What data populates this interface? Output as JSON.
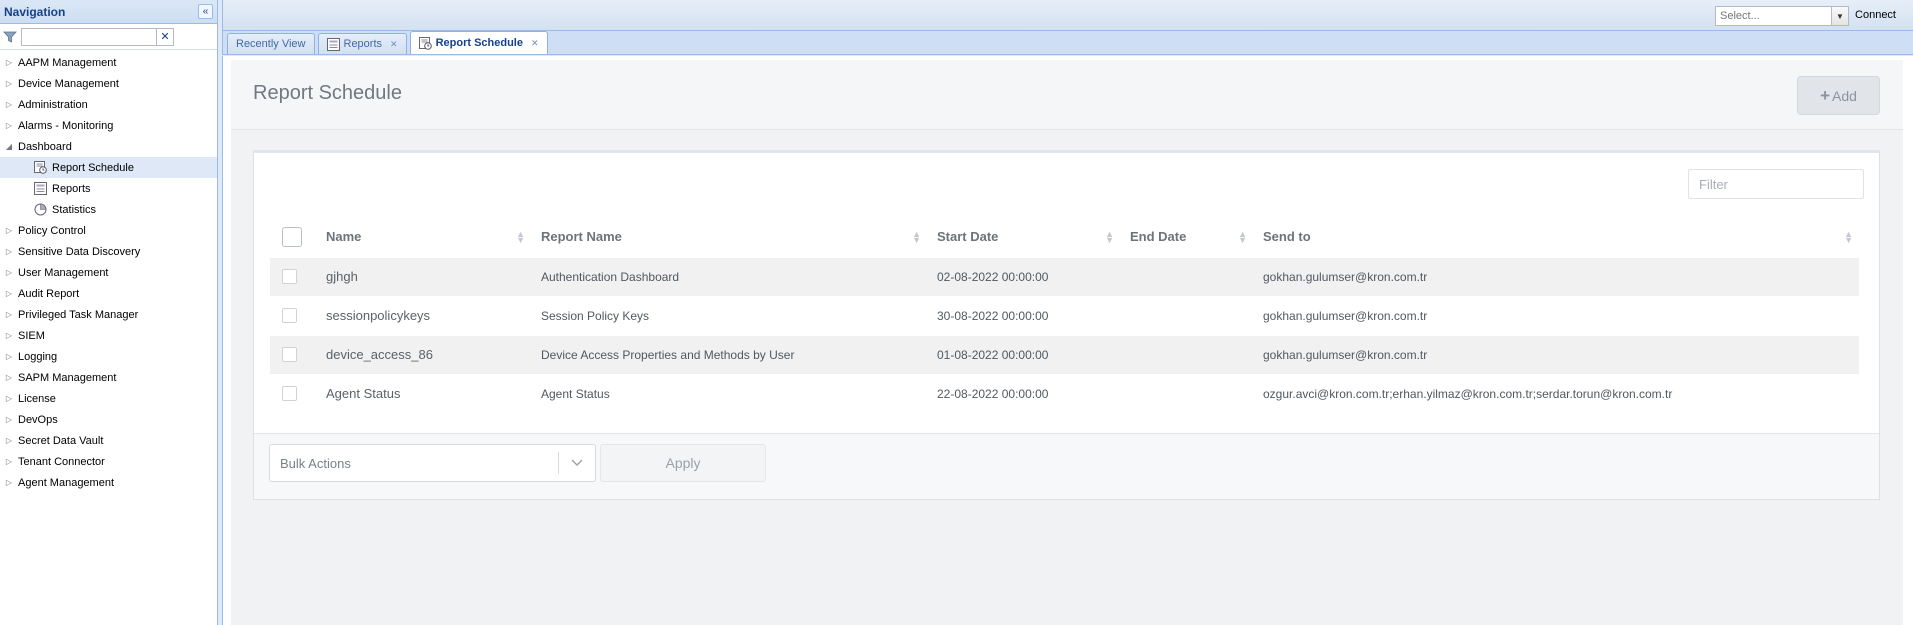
{
  "nav": {
    "title": "Navigation",
    "filter_placeholder": "",
    "clear_label": "✕",
    "items": [
      {
        "label": "AAPM Management",
        "level": 0,
        "expanded": false
      },
      {
        "label": "Device Management",
        "level": 0,
        "expanded": false
      },
      {
        "label": "Administration",
        "level": 0,
        "expanded": false
      },
      {
        "label": "Alarms - Monitoring",
        "level": 0,
        "expanded": false
      },
      {
        "label": "Dashboard",
        "level": 0,
        "expanded": true
      },
      {
        "label": "Report Schedule",
        "level": 1,
        "icon": "report-schedule-icon",
        "selected": true
      },
      {
        "label": "Reports",
        "level": 1,
        "icon": "reports-icon"
      },
      {
        "label": "Statistics",
        "level": 1,
        "icon": "statistics-icon"
      },
      {
        "label": "Policy Control",
        "level": 0,
        "expanded": false
      },
      {
        "label": "Sensitive Data Discovery",
        "level": 0,
        "expanded": false
      },
      {
        "label": "User Management",
        "level": 0,
        "expanded": false
      },
      {
        "label": "Audit Report",
        "level": 0,
        "expanded": false
      },
      {
        "label": "Privileged Task Manager",
        "level": 0,
        "expanded": false
      },
      {
        "label": "SIEM",
        "level": 0,
        "expanded": false
      },
      {
        "label": "Logging",
        "level": 0,
        "expanded": false
      },
      {
        "label": "SAPM Management",
        "level": 0,
        "expanded": false
      },
      {
        "label": "License",
        "level": 0,
        "expanded": false
      },
      {
        "label": "DevOps",
        "level": 0,
        "expanded": false
      },
      {
        "label": "Secret Data Vault",
        "level": 0,
        "expanded": false
      },
      {
        "label": "Tenant Connector",
        "level": 0,
        "expanded": false
      },
      {
        "label": "Agent Management",
        "level": 0,
        "expanded": false
      }
    ]
  },
  "topbar": {
    "select_placeholder": "Select...",
    "connect_label": "Connect"
  },
  "tabs": [
    {
      "label": "Recently View",
      "icon": null,
      "closable": false,
      "active": false
    },
    {
      "label": "Reports",
      "icon": "reports-icon",
      "closable": true,
      "active": false
    },
    {
      "label": "Report Schedule",
      "icon": "report-schedule-icon",
      "closable": true,
      "active": true
    }
  ],
  "page": {
    "title": "Report Schedule",
    "add_label": "Add",
    "filter_placeholder": "Filter"
  },
  "table": {
    "columns": [
      "Name",
      "Report Name",
      "Start Date",
      "End Date",
      "Send to"
    ],
    "rows": [
      {
        "name": "gjhgh",
        "report": "Authentication Dashboard",
        "start": "02-08-2022 00:00:00",
        "end": "",
        "send_to": "gokhan.gulumser@kron.com.tr"
      },
      {
        "name": "sessionpolicykeys",
        "report": "Session Policy Keys",
        "start": "30-08-2022 00:00:00",
        "end": "",
        "send_to": "gokhan.gulumser@kron.com.tr"
      },
      {
        "name": "device_access_86",
        "report": "Device Access Properties and Methods by User",
        "start": "01-08-2022 00:00:00",
        "end": "",
        "send_to": "gokhan.gulumser@kron.com.tr"
      },
      {
        "name": "Agent Status",
        "report": "Agent Status",
        "start": "22-08-2022 00:00:00",
        "end": "",
        "send_to": "ozgur.avci@kron.com.tr;erhan.yilmaz@kron.com.tr;serdar.torun@kron.com.tr"
      }
    ]
  },
  "footer": {
    "bulk_actions_label": "Bulk Actions",
    "apply_label": "Apply"
  },
  "colors": {
    "nav_header": "#cddef3",
    "selected_row": "#dfe8f6",
    "stripe": "#f1f1f1"
  }
}
